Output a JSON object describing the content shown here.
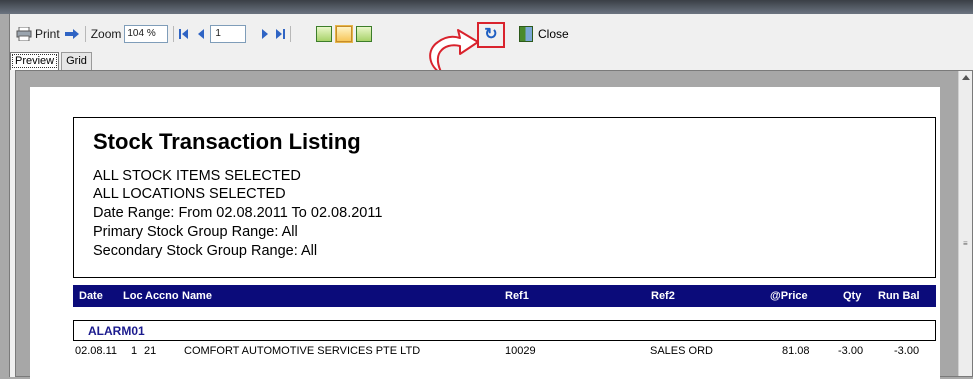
{
  "toolbar": {
    "print_label": "Print",
    "zoom_label": "Zoom",
    "zoom_value": "104 %",
    "page_value": "1",
    "close_label": "Close"
  },
  "tabs": [
    {
      "label": "Preview",
      "active": true
    },
    {
      "label": "Grid",
      "active": false
    }
  ],
  "report": {
    "title": "Stock Transaction Listing",
    "lines": [
      "ALL STOCK ITEMS SELECTED",
      "ALL LOCATIONS SELECTED",
      "Date Range: From  02.08.2011 To  02.08.2011",
      "Primary Stock Group Range: All",
      "Secondary Stock Group Range: All"
    ],
    "columns": {
      "date": "Date",
      "loc": "Loc",
      "accno": "Accno",
      "name": "Name",
      "ref1": "Ref1",
      "ref2": "Ref2",
      "price": "@Price",
      "qty": "Qty",
      "runbal": "Run Bal"
    },
    "group": "ALARM01",
    "row": {
      "date": "02.08.11",
      "loc": "1",
      "accno": "21",
      "name": "COMFORT AUTOMOTIVE SERVICES PTE LTD",
      "ref1": "10029",
      "ref2": "SALES ORD",
      "price": "81.08",
      "qty": "-3.00",
      "runbal": "-3.00"
    }
  },
  "colors": {
    "header_band": "#0b0b7a",
    "group_text": "#1b1b8e",
    "highlight_border": "#d9232d",
    "accent_icon": "#1f5fc2"
  },
  "icons": {
    "print": "printer-icon",
    "export": "export-arrow-icon",
    "first": "first-page-icon",
    "prev": "prev-page-icon",
    "next": "next-page-icon",
    "last": "last-page-icon",
    "refresh": "refresh-icon",
    "close": "close-door-icon",
    "callout": "curved-arrow-callout-icon"
  }
}
